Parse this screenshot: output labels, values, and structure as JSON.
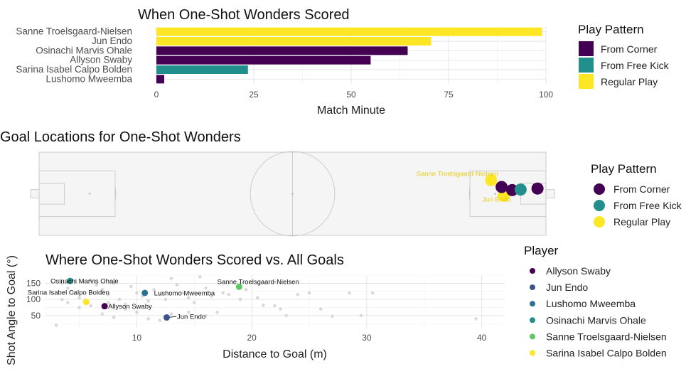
{
  "chart_data": [
    {
      "type": "bar",
      "orientation": "horizontal",
      "title": "When One-Shot Wonders Scored",
      "xlabel": "Match Minute",
      "ylabel": "",
      "xlim": [
        0,
        100
      ],
      "xticks": [
        0,
        25,
        50,
        75,
        100
      ],
      "categories": [
        "Sanne Troelsgaard-Nielsen",
        "Jun Endo",
        "Osinachi Marvis Ohale",
        "Allyson Swaby",
        "Sarina Isabel Calpo Bolden",
        "Lushomo Mweemba"
      ],
      "values": [
        99,
        70.5,
        64.5,
        55,
        23.5,
        2
      ],
      "patterns": [
        "Regular Play",
        "Regular Play",
        "From Corner",
        "From Corner",
        "From Free Kick",
        "From Corner"
      ],
      "legend": {
        "title": "Play Pattern",
        "position": "right",
        "entries": [
          {
            "label": "From Corner",
            "color": "#440154"
          },
          {
            "label": "From Free Kick",
            "color": "#21908C"
          },
          {
            "label": "Regular Play",
            "color": "#FDE725"
          }
        ]
      },
      "grid": true
    },
    {
      "type": "scatter",
      "title": "Goal Locations for One-Shot Wonders",
      "xlim": [
        0,
        120
      ],
      "ylim": [
        0,
        80
      ],
      "points": [
        {
          "x": 107,
          "y": 27,
          "pattern": "Regular Play",
          "label": "Sanne Troelsgaard-Nielsen"
        },
        {
          "x": 110,
          "y": 42,
          "pattern": "Regular Play",
          "label": "Jun Endo"
        },
        {
          "x": 109.5,
          "y": 33.5,
          "pattern": "From Corner",
          "label": ""
        },
        {
          "x": 112,
          "y": 36.5,
          "pattern": "From Corner",
          "label": ""
        },
        {
          "x": 118,
          "y": 35,
          "pattern": "From Corner",
          "label": ""
        },
        {
          "x": 114,
          "y": 36,
          "pattern": "From Free Kick",
          "label": ""
        }
      ],
      "legend": {
        "title": "Play Pattern",
        "position": "right",
        "entries": [
          {
            "label": "From Corner",
            "color": "#440154"
          },
          {
            "label": "From Free Kick",
            "color": "#21908C"
          },
          {
            "label": "Regular Play",
            "color": "#FDE725"
          }
        ]
      }
    },
    {
      "type": "scatter",
      "title": "Where One-Shot Wonders Scored vs. All Goals",
      "xlabel": "Distance to Goal (m)",
      "ylabel": "Shot Angle to Goal (°)",
      "xlim": [
        2,
        42
      ],
      "ylim": [
        10,
        175
      ],
      "xticks": [
        10,
        20,
        30,
        40
      ],
      "yticks": [
        50,
        100,
        150
      ],
      "background_points": [
        [
          3.5,
          150
        ],
        [
          4,
          135
        ],
        [
          4.5,
          120
        ],
        [
          5,
          105
        ],
        [
          5.5,
          98
        ],
        [
          6,
          160
        ],
        [
          6.5,
          145
        ],
        [
          7,
          130
        ],
        [
          7.5,
          115
        ],
        [
          8,
          150
        ],
        [
          8.5,
          100
        ],
        [
          9,
          85
        ],
        [
          9.5,
          140
        ],
        [
          10,
          120
        ],
        [
          10.5,
          110
        ],
        [
          11,
          95
        ],
        [
          11.5,
          130
        ],
        [
          12,
          115
        ],
        [
          12.5,
          100
        ],
        [
          13,
          165
        ],
        [
          13.5,
          145
        ],
        [
          14,
          120
        ],
        [
          14.5,
          105
        ],
        [
          15,
          90
        ],
        [
          15.5,
          170
        ],
        [
          16,
          135
        ],
        [
          16.5,
          110
        ],
        [
          17,
          60
        ],
        [
          17.5,
          120
        ],
        [
          18,
          115
        ],
        [
          19,
          100
        ],
        [
          19.5,
          130
        ],
        [
          20.5,
          105
        ],
        [
          21,
          82
        ],
        [
          22,
          80
        ],
        [
          22.5,
          70
        ],
        [
          23,
          50
        ],
        [
          24,
          115
        ],
        [
          25,
          120
        ],
        [
          26,
          70
        ],
        [
          27,
          48
        ],
        [
          28.5,
          120
        ],
        [
          29.5,
          50
        ],
        [
          30.5,
          120
        ],
        [
          10,
          60
        ],
        [
          13,
          55
        ],
        [
          9,
          70
        ],
        [
          5,
          75
        ],
        [
          6,
          80
        ],
        [
          4,
          90
        ],
        [
          3.5,
          100
        ],
        [
          3,
          20
        ],
        [
          7,
          55
        ],
        [
          8,
          45
        ],
        [
          11,
          40
        ],
        [
          12,
          35
        ],
        [
          14.5,
          60
        ],
        [
          16,
          50
        ],
        [
          39.5,
          40
        ],
        [
          7.5,
          90
        ]
      ],
      "points": [
        {
          "name": "Allyson Swaby",
          "x": 7.2,
          "y": 79,
          "color": "#440154",
          "label_x": 7.5,
          "label_y": 72
        },
        {
          "name": "Jun Endo",
          "x": 12.6,
          "y": 44,
          "color": "#3B528B",
          "label_x": 13.5,
          "label_y": 40
        },
        {
          "name": "Lushomo Mweemba",
          "x": 10.7,
          "y": 120,
          "color": "#2C728E",
          "label_x": 11.5,
          "label_y": 112
        },
        {
          "name": "Osinachi Marvis Ohale",
          "x": 4.2,
          "y": 157,
          "color": "#21908C",
          "label_x": 2.5,
          "label_y": 150
        },
        {
          "name": "Sanne Troelsgaard-Nielsen",
          "x": 18.9,
          "y": 139,
          "color": "#5DC863",
          "label_x": 17,
          "label_y": 148
        },
        {
          "name": "Sarina Isabel Calpo Bolden",
          "x": 5.6,
          "y": 92,
          "color": "#FDE725",
          "label_x": 0.5,
          "label_y": 115
        }
      ],
      "legend": {
        "title": "Player",
        "position": "right"
      },
      "grid": true
    }
  ],
  "legends": {
    "play_pattern_title": "Play Pattern",
    "player_title": "Player"
  }
}
